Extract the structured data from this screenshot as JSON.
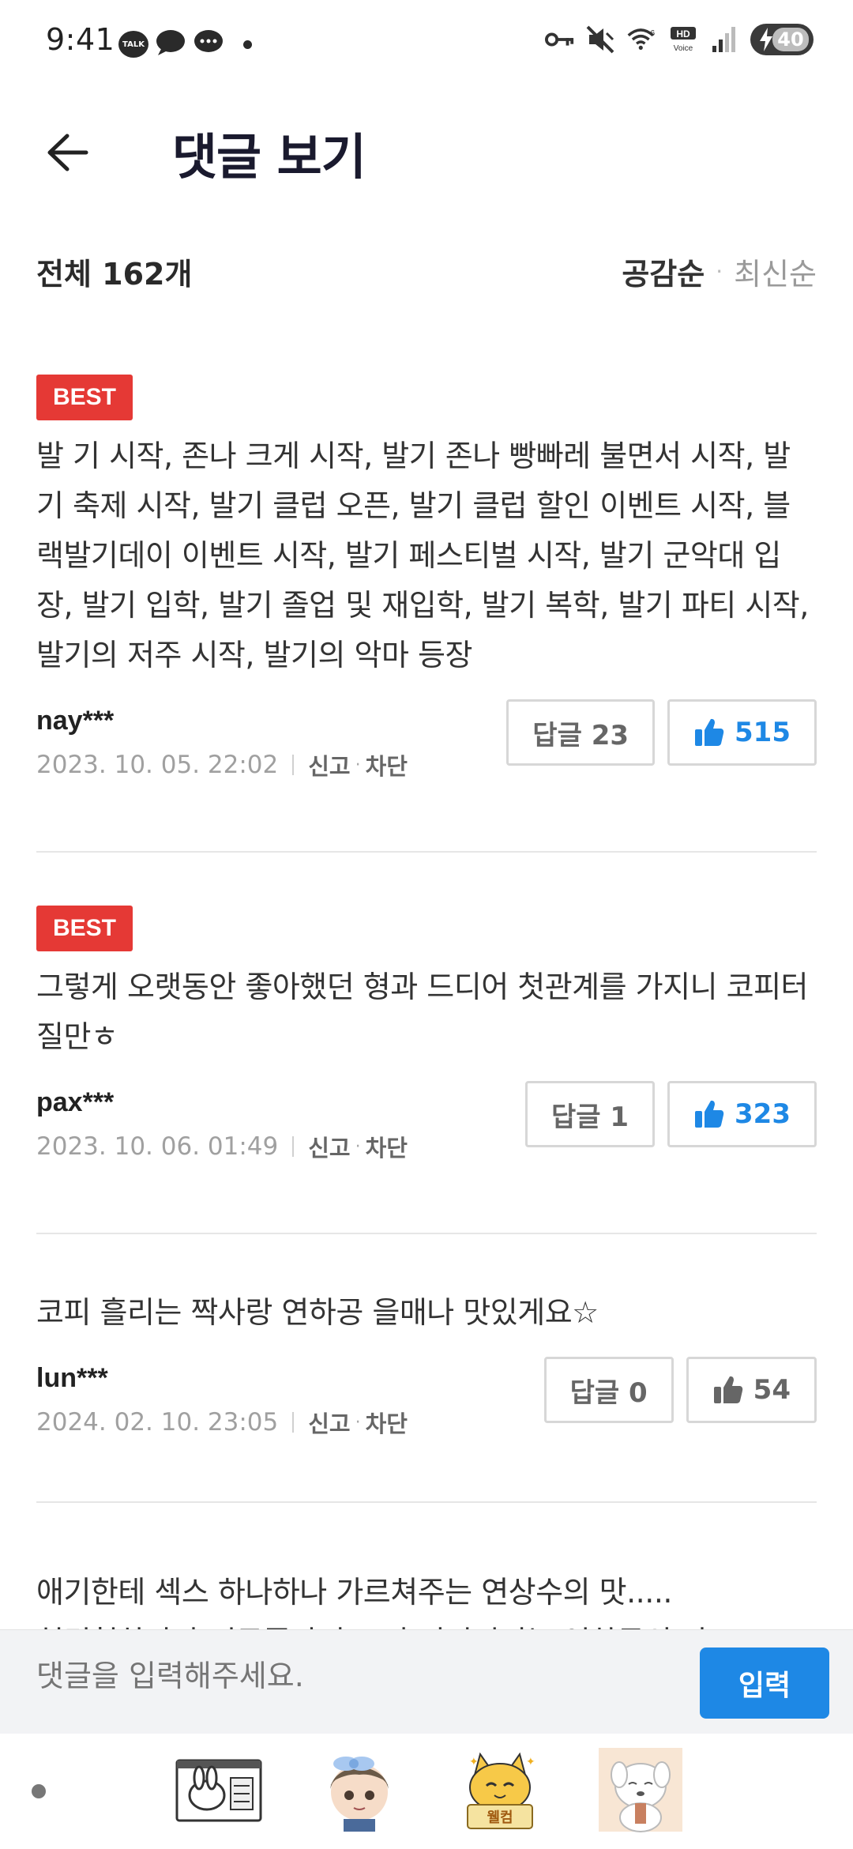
{
  "status_bar": {
    "time": "9:41",
    "notifications": [
      "kakaotalk-icon",
      "chat-bubble-icon",
      "message-icon"
    ],
    "talk_label": "TALK",
    "hd_voice": "HD Voice",
    "wifi_gen": "6",
    "battery": "40"
  },
  "header": {
    "title": "댓글 보기"
  },
  "summary": {
    "total": "전체 162개",
    "sort_options": [
      "공감순",
      "최신순"
    ],
    "active_sort": "공감순"
  },
  "comments": [
    {
      "best": true,
      "badge": "BEST",
      "text": "발 기 시작, 존나 크게 시작, 발기 존나 빵빠레 불면서 시작, 발기 축제 시작, 발기 클럽 오픈, 발기 클럽 할인 이벤트 시작, 블랙발기데이 이벤트 시작, 발기 페스티벌 시작, 발기 군악대 입장, 발기 입학, 발기 졸업 및 재입학, 발기 복학, 발기 파티 시작, 발기의 저주 시작, 발기의 악마 등장",
      "author": "nay***",
      "date": "2023. 10. 05. 22:02",
      "report": "신고",
      "block": "차단",
      "reply": "답글 23",
      "likes": "515",
      "liked_style": "blue"
    },
    {
      "best": true,
      "badge": "BEST",
      "text": "그렇게 오랫동안 좋아했던 형과 드디어 첫관계를 가지니 코피터질만ㅎ",
      "author": "pax***",
      "date": "2023. 10. 06. 01:49",
      "report": "신고",
      "block": "차단",
      "reply": "답글 1",
      "likes": "323",
      "liked_style": "blue"
    },
    {
      "best": false,
      "text": "코피 흘리는 짝사랑 연하공 을매나 맛있게요☆",
      "author": "lun***",
      "date": "2024. 02. 10. 23:05",
      "report": "신고",
      "block": "차단",
      "reply": "답글 0",
      "likes": "54",
      "liked_style": "gray"
    },
    {
      "best": false,
      "text": "애기한테 섹스 하나하나 가르쳐주는 연상수의 맛.....\n천경험하다가 너무좋아서 코피 터져버리는 연하공의 맛"
    }
  ],
  "input": {
    "placeholder": "댓글을 입력해주세요.",
    "submit": "입력"
  },
  "stickers": [
    "sticker-bunny-notepad",
    "sticker-boy-with-bow",
    "sticker-cat-welcome",
    "sticker-white-puppy"
  ],
  "sticker_welcome_text": "웰컴",
  "colors": {
    "accent": "#1e88e5",
    "best_badge": "#e53935",
    "input_bar_bg": "#f2f3f5"
  }
}
